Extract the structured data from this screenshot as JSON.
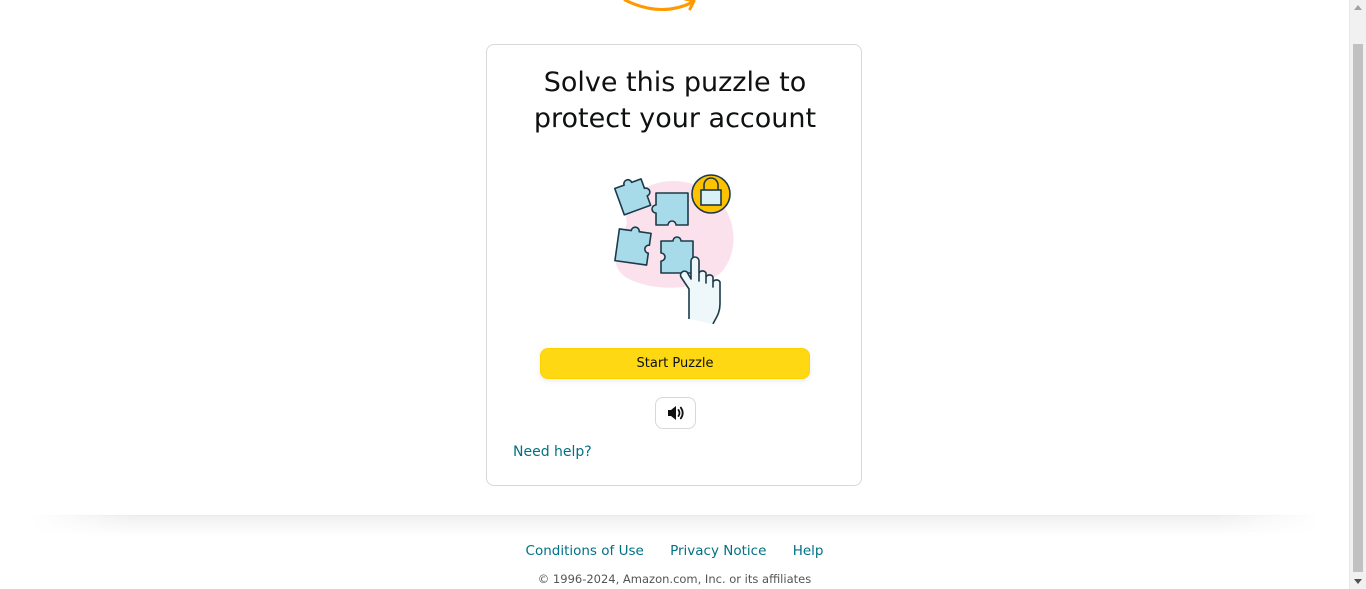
{
  "header": {
    "logo_alt": "amazon"
  },
  "puzzle_card": {
    "title_line1": "Solve this puzzle to",
    "title_line2": "protect your account",
    "start_button_label": "Start Puzzle",
    "audio_button_icon": "speaker-icon",
    "help_link_label": "Need help?"
  },
  "footer": {
    "links": [
      "Conditions of Use",
      "Privacy Notice",
      "Help"
    ],
    "copyright": "© 1996-2024, Amazon.com, Inc. or its affiliates"
  },
  "colors": {
    "button_yellow": "#ffd814",
    "link_teal": "#007185",
    "logo_orange": "#ff9900",
    "puzzle_blue": "#a8dbe9",
    "lock_yellow": "#ffc200",
    "blob_pink": "#fbe1ec"
  }
}
